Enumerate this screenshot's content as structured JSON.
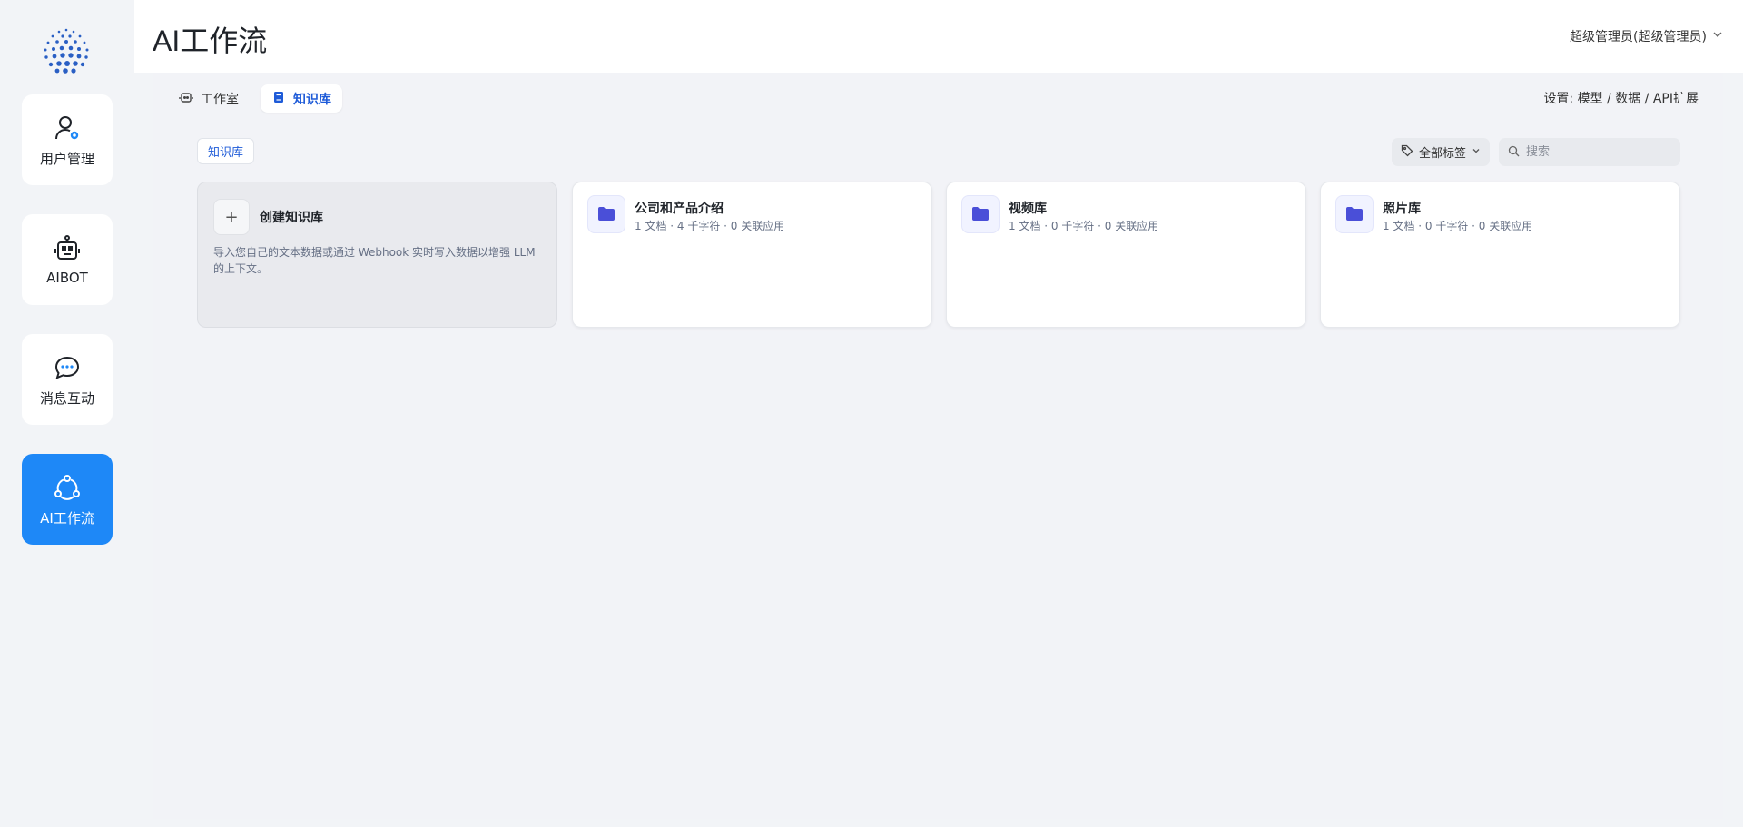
{
  "sidebar": {
    "items": [
      {
        "label": "用户管理",
        "icon": "user-settings-icon"
      },
      {
        "label": "AIBOT",
        "icon": "robot-icon"
      },
      {
        "label": "消息互动",
        "icon": "chat-bubble-icon"
      },
      {
        "label": "AI工作流",
        "icon": "workflow-icon",
        "active": true
      }
    ]
  },
  "header": {
    "title": "AI工作流",
    "user": "超级管理员(超级管理员)"
  },
  "tabs": [
    {
      "label": "工作室",
      "icon": "robot-icon"
    },
    {
      "label": "知识库",
      "icon": "book-icon",
      "active": true
    }
  ],
  "settings_link": "设置: 模型 / 数据 / API扩展",
  "toolbar": {
    "chip": "知识库",
    "tag_filter": "全部标签",
    "search_placeholder": "搜索"
  },
  "create_card": {
    "title": "创建知识库",
    "description": "导入您自己的文本数据或通过 Webhook 实时写入数据以增强 LLM 的上下文。"
  },
  "knowledge_bases": [
    {
      "name": "公司和产品介绍",
      "meta": "1 文档 · 4 千字符 · 0 关联应用"
    },
    {
      "name": "视频库",
      "meta": "1 文档 · 0 千字符 · 0 关联应用"
    },
    {
      "name": "照片库",
      "meta": "1 文档 · 0 千字符 · 0 关联应用"
    }
  ],
  "colors": {
    "accent": "#1e88f7",
    "tab_active_text": "#1e5bd8",
    "folder_icon": "#4a4fd8"
  }
}
